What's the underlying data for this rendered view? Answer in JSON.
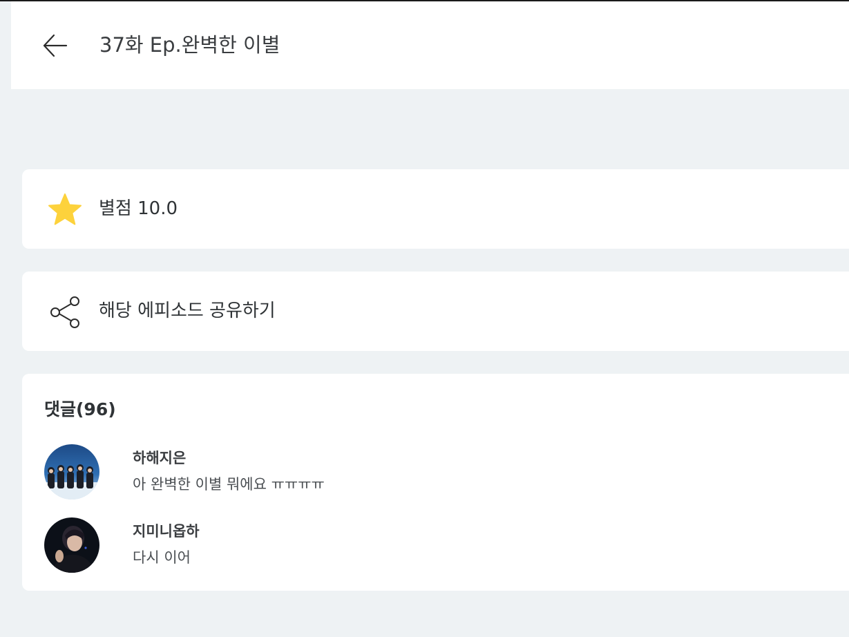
{
  "header": {
    "back_icon": "arrow-left-icon",
    "title": "37화 Ep.완벽한 이별"
  },
  "rating": {
    "icon": "star-icon",
    "icon_color": "#fdd23c",
    "label": "별점 10.0"
  },
  "share": {
    "icon": "share-icon",
    "label": "해당 에피소드 공유하기"
  },
  "comments": {
    "heading": "댓글(96)",
    "items": [
      {
        "author": "하해지은",
        "text": "아 완벽한 이별 뭐에요 ㅠㅠㅠㅠ",
        "avatar": "group-photo-avatar"
      },
      {
        "author": "지미니옵하",
        "text": "다시 이어",
        "avatar": "portrait-avatar"
      }
    ]
  }
}
